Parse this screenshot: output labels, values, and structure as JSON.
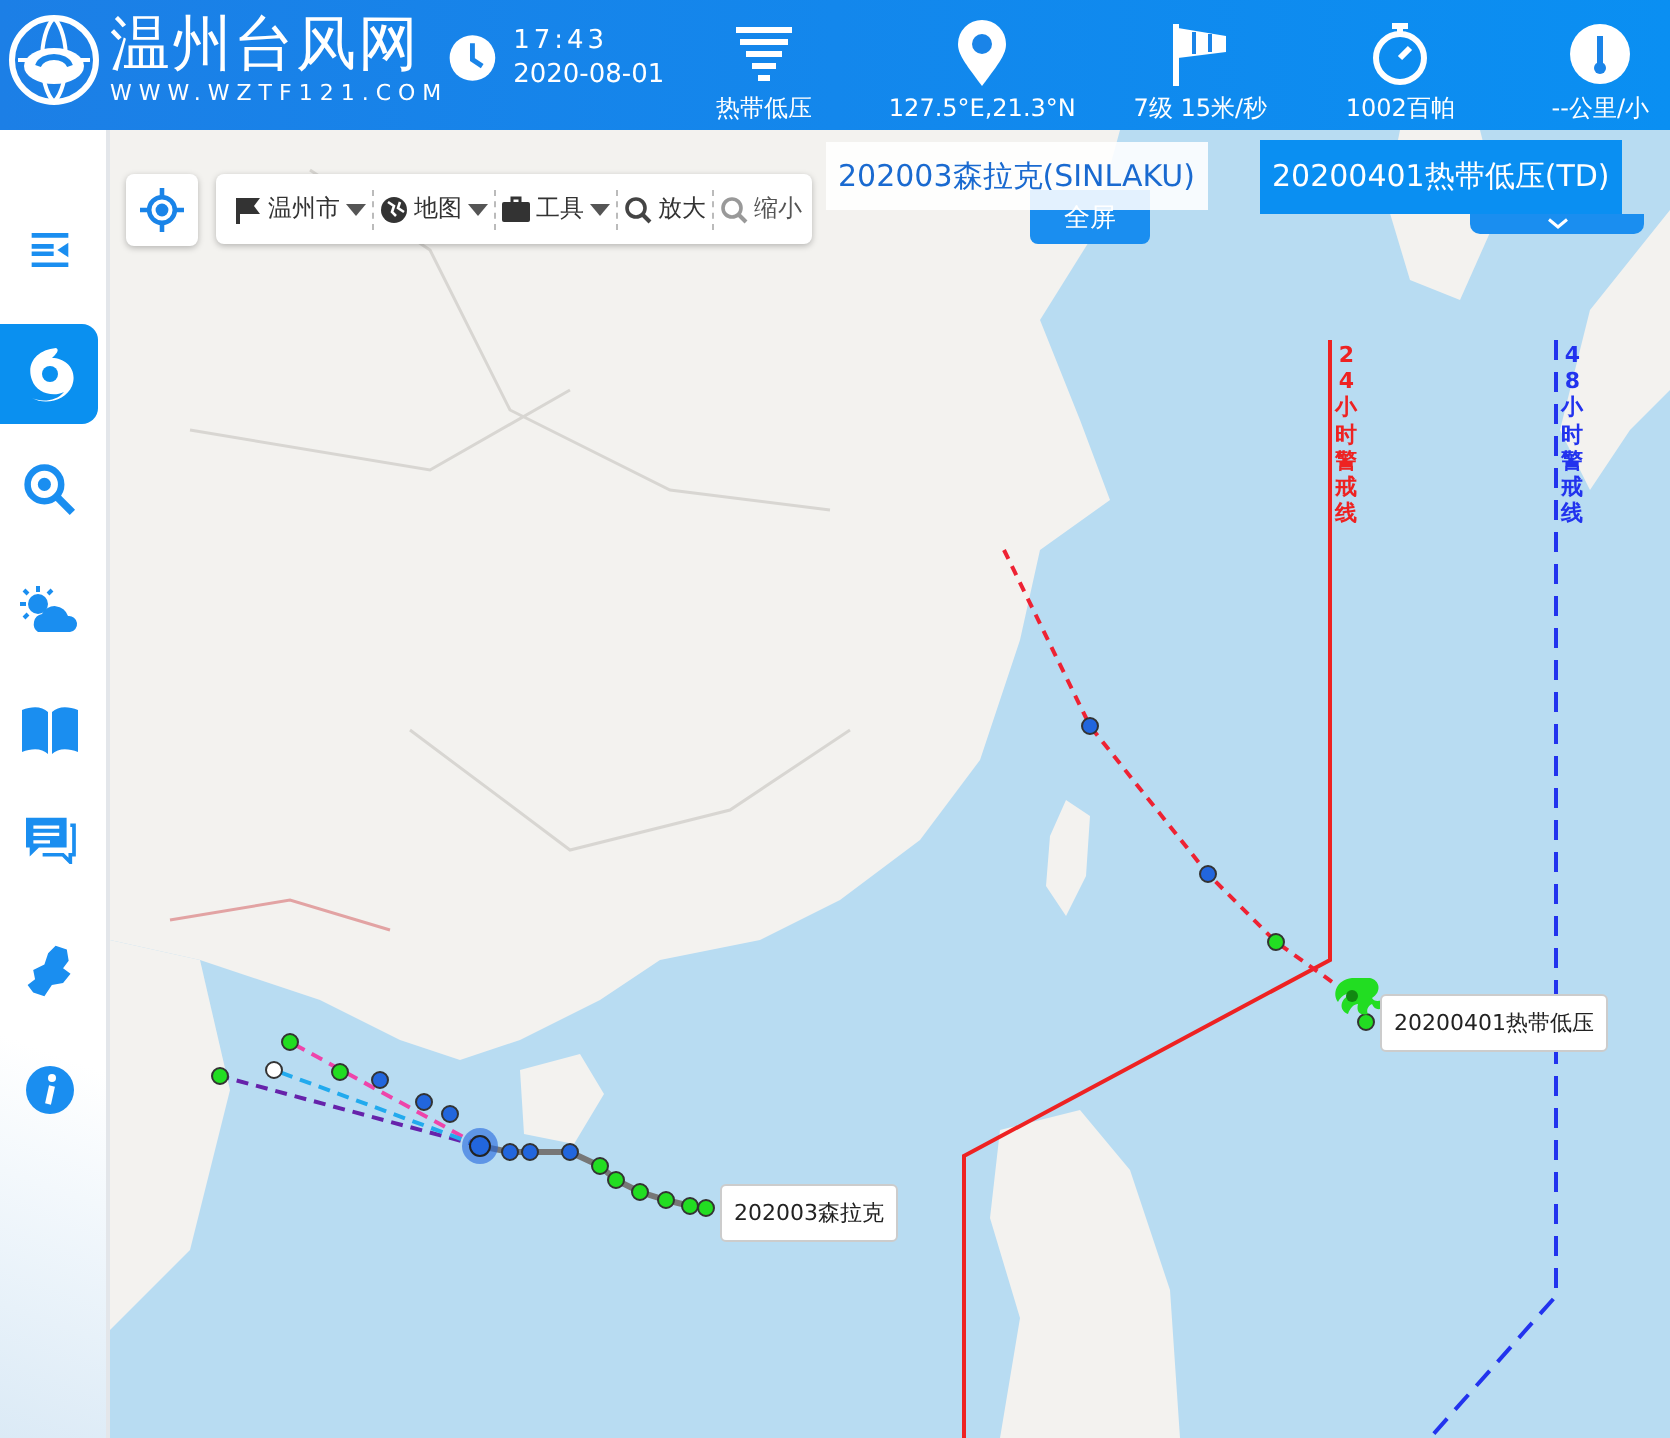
{
  "header": {
    "title": "温州台风网",
    "url": "WWW.WZTF121.COM",
    "time": "17:43",
    "date": "2020-08-01",
    "info": [
      {
        "kind": "intensity",
        "text": "热带低压"
      },
      {
        "kind": "position",
        "text": "127.5°E,21.3°N"
      },
      {
        "kind": "wind",
        "text": "7级 15米/秒"
      },
      {
        "kind": "pressure",
        "text": "1002百帕"
      },
      {
        "kind": "speed",
        "text": "--公里/小"
      }
    ]
  },
  "sidebar": {
    "items": [
      {
        "kind": "collapse",
        "selected": false
      },
      {
        "kind": "typhoon",
        "selected": true
      },
      {
        "kind": "search",
        "selected": false
      },
      {
        "kind": "weather",
        "selected": false
      },
      {
        "kind": "book",
        "selected": false
      },
      {
        "kind": "chat",
        "selected": false
      },
      {
        "kind": "region",
        "selected": false
      },
      {
        "kind": "info",
        "selected": false
      }
    ]
  },
  "toolbar": {
    "menus": [
      {
        "kind": "flag",
        "label": "温州市"
      },
      {
        "kind": "globe",
        "label": "地图"
      },
      {
        "kind": "toolbox",
        "label": "工具"
      }
    ],
    "buttons": [
      {
        "kind": "zoom-in",
        "label": "放大"
      },
      {
        "kind": "zoom-out",
        "label": "缩小"
      }
    ],
    "fullscreen": "全屏"
  },
  "typhoon_tabs": [
    {
      "label": "202003森拉克(SINLAKU)",
      "selected": false
    },
    {
      "label": "20200401热带低压(TD)",
      "selected": true
    }
  ],
  "map": {
    "warning_lines": [
      {
        "kind": "solid",
        "label": "24小时警戒线",
        "color": "#ee2222"
      },
      {
        "kind": "dashed",
        "label": "48小时警戒线",
        "color": "#2233ee"
      }
    ],
    "typhoon_labels": [
      "202003森拉克",
      "20200401热带低压"
    ]
  }
}
